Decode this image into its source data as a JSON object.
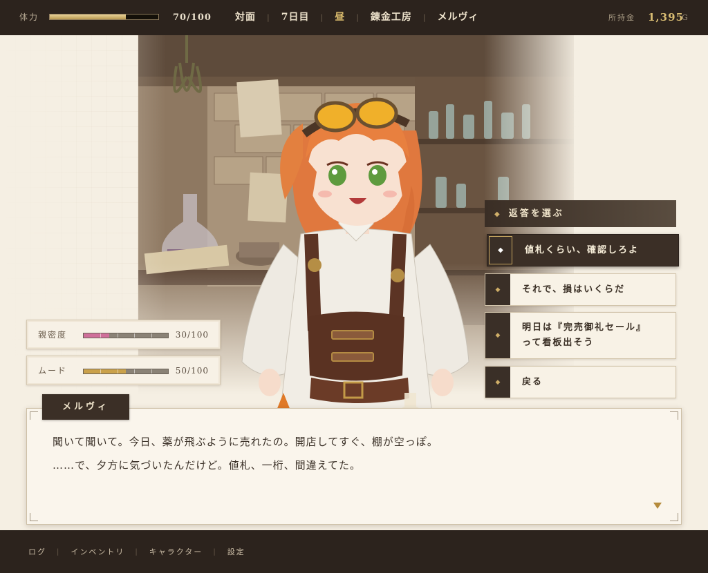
{
  "status": {
    "hp_label": "体力",
    "hp_current": 70,
    "hp_max": 100,
    "hp_text": "70/100"
  },
  "breadcrumb": {
    "items": [
      "対面",
      "7日目",
      "昼",
      "錬金工房",
      "メルヴィ"
    ],
    "separator": "|"
  },
  "money": {
    "label": "所持金",
    "value": "1,395",
    "unit": "G"
  },
  "stats": {
    "affinity": {
      "label": "親密度",
      "value": 30,
      "max": 100,
      "text": "30/100",
      "color": "#cf6f9a"
    },
    "mood": {
      "label": "ムード",
      "value": 50,
      "max": 100,
      "text": "50/100",
      "color": "#caa14a"
    }
  },
  "responses": {
    "heading": "返答を選ぶ",
    "options": [
      {
        "text": "値札くらい、確認しろよ",
        "selected": true
      },
      {
        "text": "それで、損はいくらだ",
        "selected": false
      },
      {
        "text_line1": "明日は『完売御礼セール』",
        "text_line2": "って看板出そう",
        "selected": false
      },
      {
        "text": "戻る",
        "selected": false
      }
    ]
  },
  "dialogue": {
    "speaker": "メルヴィ",
    "line1": "聞いて聞いて。今日、薬が飛ぶように売れたの。開店してすぐ、棚が空っぽ。",
    "line2": "……で、夕方に気づいたんだけど。値札、一桁、間違えてた。"
  },
  "menu": {
    "items": [
      "ログ",
      "インベントリ",
      "キャラクター",
      "設定"
    ]
  },
  "icons": {
    "option_marker": "diamond-icon",
    "advance": "triangle-down-icon"
  }
}
